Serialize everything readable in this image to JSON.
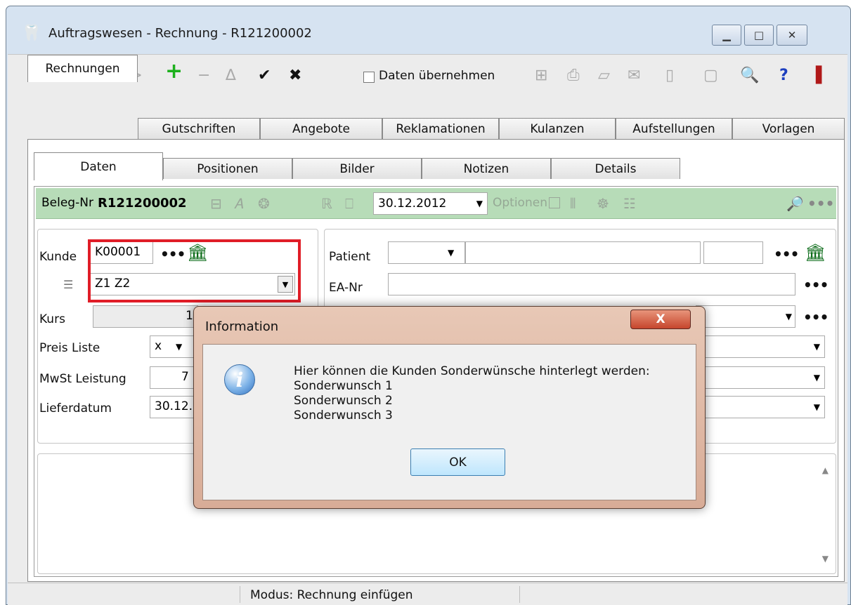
{
  "window": {
    "title": "Auftragswesen - Rechnung - R121200002",
    "app_icon": "tooth-icon",
    "controls": [
      "minimize-icon",
      "maximize-icon",
      "close-icon"
    ]
  },
  "toolbar": {
    "daten_uebernehmen_label": "Daten übernehmen",
    "daten_uebernehmen_checked": false,
    "help_symbol": "?"
  },
  "tabs_main": [
    {
      "label": "Rechnungen",
      "active": true
    },
    {
      "label": "Gutschriften",
      "active": false
    },
    {
      "label": "Angebote",
      "active": false
    },
    {
      "label": "Reklamationen",
      "active": false
    },
    {
      "label": "Kulanzen",
      "active": false
    },
    {
      "label": "Aufstellungen",
      "active": false
    },
    {
      "label": "Vorlagen",
      "active": false
    }
  ],
  "tabs_sub": [
    {
      "label": "Daten",
      "active": true
    },
    {
      "label": "Positionen",
      "active": false
    },
    {
      "label": "Bilder",
      "active": false
    },
    {
      "label": "Notizen",
      "active": false
    },
    {
      "label": "Details",
      "active": false
    }
  ],
  "greenbar": {
    "beleg_label": "Beleg-Nr",
    "beleg_value": "R121200002",
    "date_value": "30.12.2012",
    "optionen_label": "Optionen"
  },
  "form_left": {
    "kunde_label": "Kunde",
    "kunde_value": "K00001",
    "address_value": "Z1 Z2",
    "kurs_label": "Kurs",
    "kurs_value": "1",
    "preisliste_label": "Preis Liste",
    "preisliste_value": "x",
    "mwst_label": "MwSt Leistung",
    "mwst_value": "7",
    "lieferdatum_label": "Lieferdatum",
    "lieferdatum_value": "30.12."
  },
  "form_right": {
    "patient_label": "Patient",
    "ea_label": "EA-Nr"
  },
  "status": {
    "text": "Modus:  Rechnung einfügen"
  },
  "dialog": {
    "title": "Information",
    "close_symbol": "X",
    "message_lines": [
      "Hier können die Kunden Sonderwünsche hinterlegt werden:",
      "Sonderwunsch 1",
      "Sonderwunsch 2",
      "Sonderwunsch 3"
    ],
    "ok_label": "OK",
    "icon": "info-icon"
  }
}
